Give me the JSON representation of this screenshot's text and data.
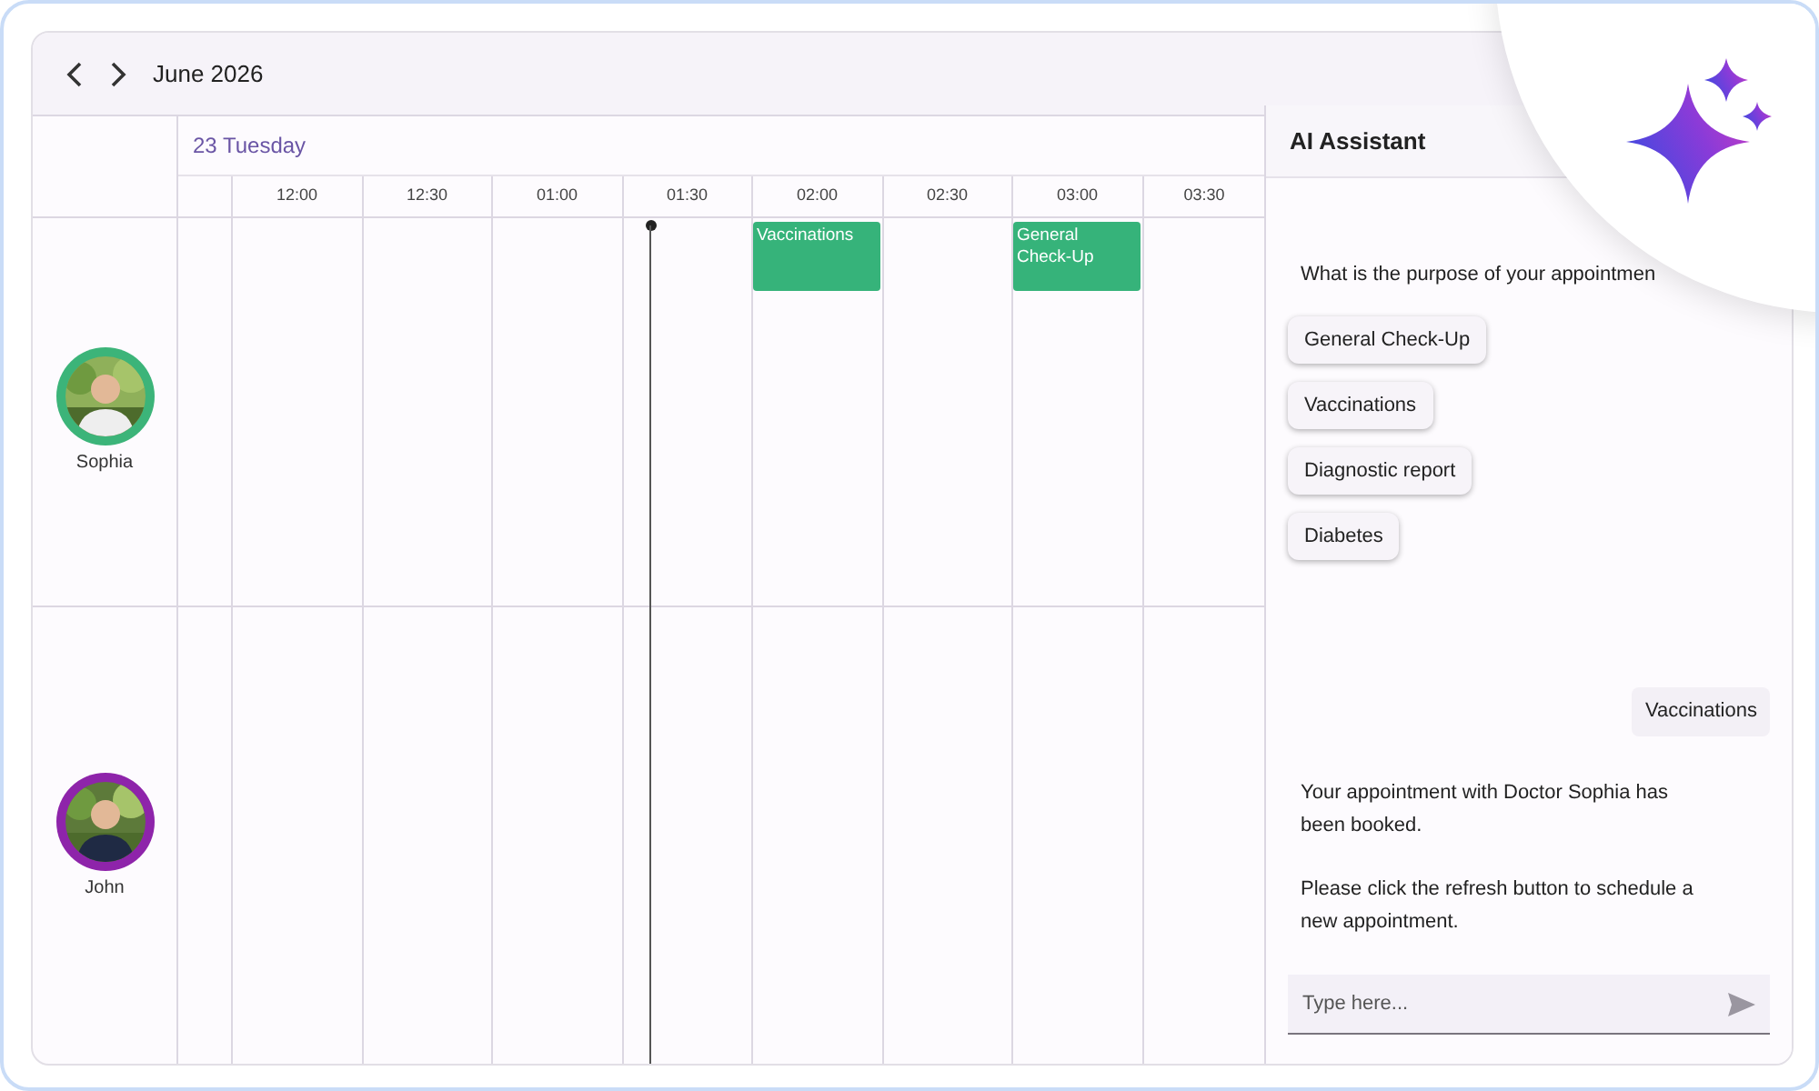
{
  "toolbar": {
    "month_label": "June 2026"
  },
  "day_label": "23 Tuesday",
  "time_slots": [
    "12:00",
    "12:30",
    "01:00",
    "01:30",
    "02:00",
    "02:30",
    "03:00",
    "03:30"
  ],
  "resources": [
    {
      "name": "Sophia",
      "color": "#3cb479",
      "cells": [
        {
          "booked": false
        },
        {
          "booked": false
        },
        {
          "booked": false
        },
        {
          "booked": false
        },
        {
          "booked": true,
          "title": "Vaccinations"
        },
        {
          "booked": false
        },
        {
          "booked": true,
          "title": "General Check-Up"
        },
        {
          "booked": false
        }
      ]
    },
    {
      "name": "John",
      "color": "#8e24aa",
      "cells": [
        {
          "booked": false
        },
        {
          "booked": false
        },
        {
          "booked": false
        },
        {
          "booked": false
        },
        {
          "booked": false
        },
        {
          "booked": false
        },
        {
          "booked": false
        },
        {
          "booked": false
        }
      ]
    }
  ],
  "assistant": {
    "title": "AI Assistant",
    "messages": [
      {
        "kind": "bot",
        "text": "What is the purpose of your appointmen"
      },
      {
        "kind": "options",
        "options": [
          "General Check-Up",
          "Vaccinations",
          "Diagnostic report",
          "Diabetes"
        ]
      },
      {
        "kind": "user",
        "text": "Vaccinations"
      },
      {
        "kind": "bot",
        "text": "Your appointment with Doctor Sophia has been booked."
      },
      {
        "kind": "bot",
        "text": "Please click the refresh button to schedule a new appointment."
      }
    ],
    "input": {
      "placeholder": "Type here..."
    }
  }
}
